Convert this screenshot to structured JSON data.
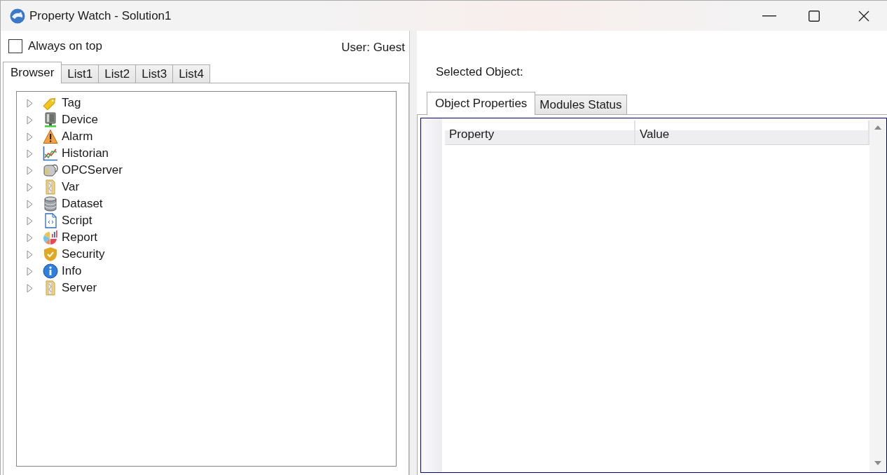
{
  "window": {
    "title": "Property Watch - Solution1"
  },
  "left_panel": {
    "always_on_top": {
      "label": "Always on top",
      "checked": false
    },
    "user": "User: Guest",
    "tabs": [
      {
        "label": "Browser",
        "selected": true
      },
      {
        "label": "List1",
        "selected": false
      },
      {
        "label": "List2",
        "selected": false
      },
      {
        "label": "List3",
        "selected": false
      },
      {
        "label": "List4",
        "selected": false
      }
    ],
    "tree": [
      {
        "label": "Tag",
        "kind": "tag",
        "expanded": false
      },
      {
        "label": "Device",
        "kind": "device",
        "expanded": false
      },
      {
        "label": "Alarm",
        "kind": "alarm",
        "expanded": false
      },
      {
        "label": "Historian",
        "kind": "historian",
        "expanded": false
      },
      {
        "label": "OPCServer",
        "kind": "opcserver",
        "expanded": false
      },
      {
        "label": "Var",
        "kind": "folder",
        "expanded": false
      },
      {
        "label": "Dataset",
        "kind": "dataset",
        "expanded": false
      },
      {
        "label": "Script",
        "kind": "script",
        "expanded": false
      },
      {
        "label": "Report",
        "kind": "report",
        "expanded": false
      },
      {
        "label": "Security",
        "kind": "security",
        "expanded": false
      },
      {
        "label": "Info",
        "kind": "info",
        "expanded": false
      },
      {
        "label": "Server",
        "kind": "folder",
        "expanded": false
      }
    ]
  },
  "right_panel": {
    "selected_object": "Selected Object:",
    "tabs": [
      {
        "label": "Object Properties",
        "selected": true
      },
      {
        "label": "Modules Status",
        "selected": false
      }
    ],
    "grid": {
      "columns": [
        {
          "label": "Property"
        },
        {
          "label": "Value"
        }
      ]
    }
  }
}
